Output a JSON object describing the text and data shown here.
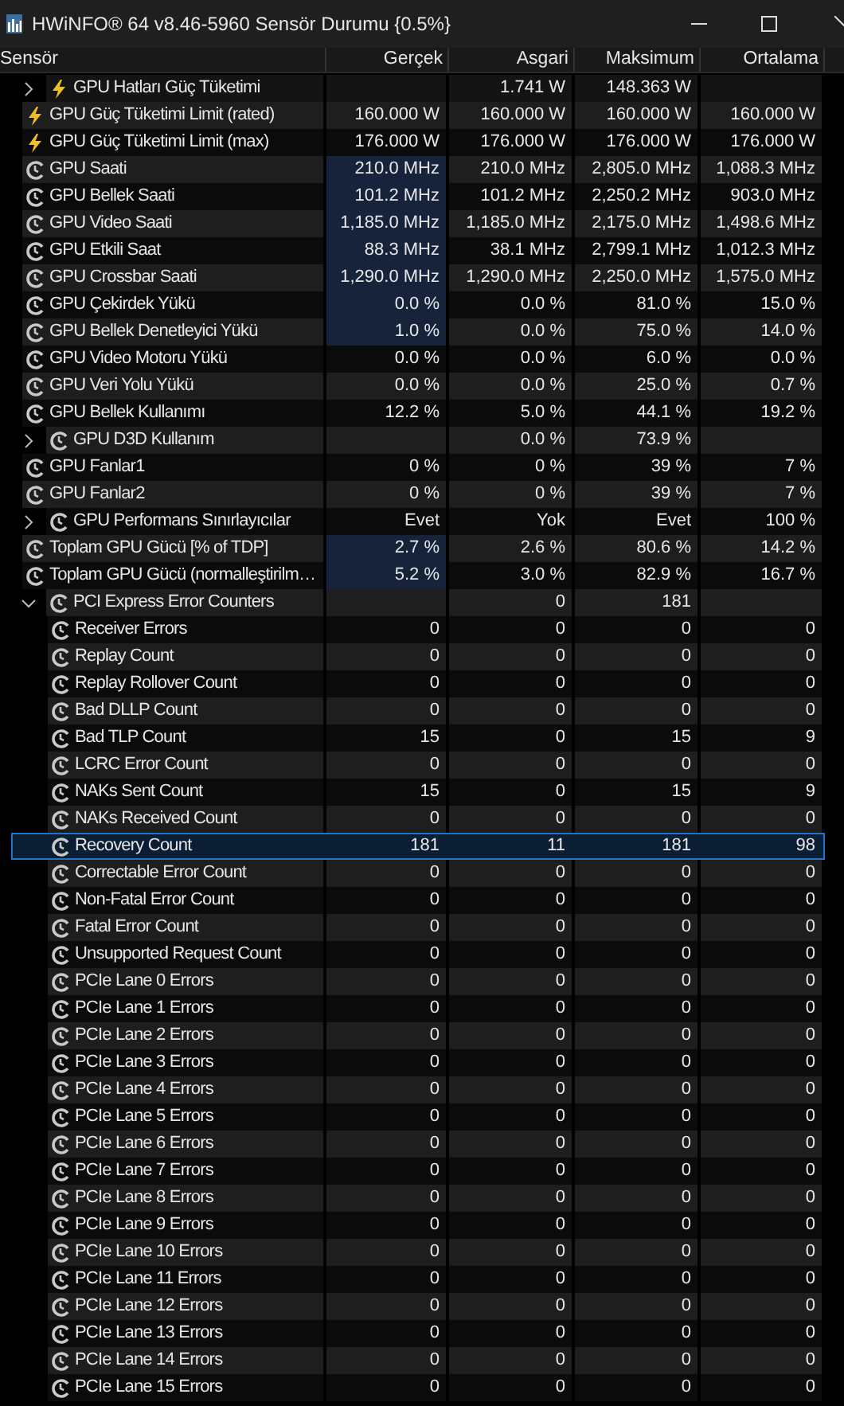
{
  "window": {
    "title": "HWiNFO® 64 v8.46-5960 Sensör Durumu {0.5%}"
  },
  "columns": [
    "Sensör",
    "Gerçek",
    "Asgari",
    "Maksimum",
    "Ortalama"
  ],
  "rows": [
    {
      "label": "GPU Hatları Güç Tüketimi",
      "kind": "power",
      "expanded": false,
      "min": "1.741 W",
      "max": "148.363 W",
      "highlight": false,
      "selected": false
    },
    {
      "label": "GPU Güç Tüketimi Limit (rated)",
      "kind": "power",
      "current": "160.000 W",
      "min": "160.000 W",
      "max": "160.000 W",
      "avg": "160.000 W",
      "highlight": false,
      "selected": false
    },
    {
      "label": "GPU Güç Tüketimi Limit (max)",
      "kind": "power",
      "current": "176.000 W",
      "min": "176.000 W",
      "max": "176.000 W",
      "avg": "176.000 W",
      "highlight": false,
      "selected": false
    },
    {
      "label": "GPU Saati",
      "kind": "clock",
      "current": "210.0 MHz",
      "min": "210.0 MHz",
      "max": "2,805.0 MHz",
      "avg": "1,088.3 MHz",
      "highlight": true,
      "selected": false
    },
    {
      "label": "GPU Bellek Saati",
      "kind": "clock",
      "current": "101.2 MHz",
      "min": "101.2 MHz",
      "max": "2,250.2 MHz",
      "avg": "903.0 MHz",
      "highlight": true,
      "selected": false
    },
    {
      "label": "GPU Video Saati",
      "kind": "clock",
      "current": "1,185.0 MHz",
      "min": "1,185.0 MHz",
      "max": "2,175.0 MHz",
      "avg": "1,498.6 MHz",
      "highlight": true,
      "selected": false
    },
    {
      "label": "GPU Etkili Saat",
      "kind": "clock",
      "current": "88.3 MHz",
      "min": "38.1 MHz",
      "max": "2,799.1 MHz",
      "avg": "1,012.3 MHz",
      "highlight": true,
      "selected": false
    },
    {
      "label": "GPU Crossbar Saati",
      "kind": "clock",
      "current": "1,290.0 MHz",
      "min": "1,290.0 MHz",
      "max": "2,250.0 MHz",
      "avg": "1,575.0 MHz",
      "highlight": true,
      "selected": false
    },
    {
      "label": "GPU Çekirdek Yükü",
      "kind": "clock",
      "current": "0.0 %",
      "min": "0.0 %",
      "max": "81.0 %",
      "avg": "15.0 %",
      "highlight": true,
      "selected": false
    },
    {
      "label": "GPU Bellek Denetleyici Yükü",
      "kind": "clock",
      "current": "1.0 %",
      "min": "0.0 %",
      "max": "75.0 %",
      "avg": "14.0 %",
      "highlight": true,
      "selected": false
    },
    {
      "label": "GPU Video Motoru Yükü",
      "kind": "clock",
      "current": "0.0 %",
      "min": "0.0 %",
      "max": "6.0 %",
      "avg": "0.0 %",
      "highlight": false,
      "selected": false
    },
    {
      "label": "GPU Veri Yolu Yükü",
      "kind": "clock",
      "current": "0.0 %",
      "min": "0.0 %",
      "max": "25.0 %",
      "avg": "0.7 %",
      "highlight": false,
      "selected": false
    },
    {
      "label": "GPU Bellek Kullanımı",
      "kind": "clock",
      "current": "12.2 %",
      "min": "5.0 %",
      "max": "44.1 %",
      "avg": "19.2 %",
      "highlight": false,
      "selected": false
    },
    {
      "label": "GPU D3D Kullanım",
      "kind": "clock",
      "expanded": false,
      "min": "0.0 %",
      "max": "73.9 %",
      "highlight": false,
      "selected": false
    },
    {
      "label": "GPU Fanlar1",
      "kind": "clock",
      "current": "0 %",
      "min": "0 %",
      "max": "39 %",
      "avg": "7 %",
      "highlight": false,
      "selected": false
    },
    {
      "label": "GPU Fanlar2",
      "kind": "clock",
      "current": "0 %",
      "min": "0 %",
      "max": "39 %",
      "avg": "7 %",
      "highlight": false,
      "selected": false
    },
    {
      "label": "GPU Performans Sınırlayıcılar",
      "kind": "clock",
      "expanded": false,
      "current": "Evet",
      "min": "Yok",
      "max": "Evet",
      "avg": "100 %",
      "highlight": false,
      "selected": false
    },
    {
      "label": "Toplam GPU Gücü [% of TDP]",
      "kind": "clock",
      "current": "2.7 %",
      "min": "2.6 %",
      "max": "80.6 %",
      "avg": "14.2 %",
      "highlight": true,
      "selected": false
    },
    {
      "label": "Toplam GPU Gücü (normalleştirilm…",
      "kind": "clock",
      "current": "5.2 %",
      "min": "3.0 %",
      "max": "82.9 %",
      "avg": "16.7 %",
      "highlight": true,
      "selected": false
    },
    {
      "label": "PCI Express Error Counters",
      "kind": "clock",
      "expanded": true,
      "min": "0",
      "max": "181",
      "highlight": false,
      "selected": false,
      "children": [
        {
          "label": "Receiver Errors",
          "kind": "clock",
          "current": "0",
          "min": "0",
          "max": "0",
          "avg": "0",
          "highlight": false,
          "selected": false
        },
        {
          "label": "Replay Count",
          "kind": "clock",
          "current": "0",
          "min": "0",
          "max": "0",
          "avg": "0",
          "highlight": false,
          "selected": false
        },
        {
          "label": "Replay Rollover Count",
          "kind": "clock",
          "current": "0",
          "min": "0",
          "max": "0",
          "avg": "0",
          "highlight": false,
          "selected": false
        },
        {
          "label": "Bad DLLP Count",
          "kind": "clock",
          "current": "0",
          "min": "0",
          "max": "0",
          "avg": "0",
          "highlight": false,
          "selected": false
        },
        {
          "label": "Bad TLP Count",
          "kind": "clock",
          "current": "15",
          "min": "0",
          "max": "15",
          "avg": "9",
          "highlight": false,
          "selected": false
        },
        {
          "label": "LCRC Error Count",
          "kind": "clock",
          "current": "0",
          "min": "0",
          "max": "0",
          "avg": "0",
          "highlight": false,
          "selected": false
        },
        {
          "label": "NAKs Sent Count",
          "kind": "clock",
          "current": "15",
          "min": "0",
          "max": "15",
          "avg": "9",
          "highlight": false,
          "selected": false
        },
        {
          "label": "NAKs Received Count",
          "kind": "clock",
          "current": "0",
          "min": "0",
          "max": "0",
          "avg": "0",
          "highlight": false,
          "selected": false
        },
        {
          "label": "Recovery Count",
          "kind": "clock",
          "current": "181",
          "min": "11",
          "max": "181",
          "avg": "98",
          "highlight": false,
          "selected": true
        },
        {
          "label": "Correctable Error Count",
          "kind": "clock",
          "current": "0",
          "min": "0",
          "max": "0",
          "avg": "0",
          "highlight": false,
          "selected": false
        },
        {
          "label": "Non-Fatal Error Count",
          "kind": "clock",
          "current": "0",
          "min": "0",
          "max": "0",
          "avg": "0",
          "highlight": false,
          "selected": false
        },
        {
          "label": "Fatal Error Count",
          "kind": "clock",
          "current": "0",
          "min": "0",
          "max": "0",
          "avg": "0",
          "highlight": false,
          "selected": false
        },
        {
          "label": "Unsupported Request Count",
          "kind": "clock",
          "current": "0",
          "min": "0",
          "max": "0",
          "avg": "0",
          "highlight": false,
          "selected": false
        },
        {
          "label": "PCIe Lane 0 Errors",
          "kind": "clock",
          "current": "0",
          "min": "0",
          "max": "0",
          "avg": "0",
          "highlight": false,
          "selected": false
        },
        {
          "label": "PCIe Lane 1 Errors",
          "kind": "clock",
          "current": "0",
          "min": "0",
          "max": "0",
          "avg": "0",
          "highlight": false,
          "selected": false
        },
        {
          "label": "PCIe Lane 2 Errors",
          "kind": "clock",
          "current": "0",
          "min": "0",
          "max": "0",
          "avg": "0",
          "highlight": false,
          "selected": false
        },
        {
          "label": "PCIe Lane 3 Errors",
          "kind": "clock",
          "current": "0",
          "min": "0",
          "max": "0",
          "avg": "0",
          "highlight": false,
          "selected": false
        },
        {
          "label": "PCIe Lane 4 Errors",
          "kind": "clock",
          "current": "0",
          "min": "0",
          "max": "0",
          "avg": "0",
          "highlight": false,
          "selected": false
        },
        {
          "label": "PCIe Lane 5 Errors",
          "kind": "clock",
          "current": "0",
          "min": "0",
          "max": "0",
          "avg": "0",
          "highlight": false,
          "selected": false
        },
        {
          "label": "PCIe Lane 6 Errors",
          "kind": "clock",
          "current": "0",
          "min": "0",
          "max": "0",
          "avg": "0",
          "highlight": false,
          "selected": false
        },
        {
          "label": "PCIe Lane 7 Errors",
          "kind": "clock",
          "current": "0",
          "min": "0",
          "max": "0",
          "avg": "0",
          "highlight": false,
          "selected": false
        },
        {
          "label": "PCIe Lane 8 Errors",
          "kind": "clock",
          "current": "0",
          "min": "0",
          "max": "0",
          "avg": "0",
          "highlight": false,
          "selected": false
        },
        {
          "label": "PCIe Lane 9 Errors",
          "kind": "clock",
          "current": "0",
          "min": "0",
          "max": "0",
          "avg": "0",
          "highlight": false,
          "selected": false
        },
        {
          "label": "PCIe Lane 10 Errors",
          "kind": "clock",
          "current": "0",
          "min": "0",
          "max": "0",
          "avg": "0",
          "highlight": false,
          "selected": false
        },
        {
          "label": "PCIe Lane 11 Errors",
          "kind": "clock",
          "current": "0",
          "min": "0",
          "max": "0",
          "avg": "0",
          "highlight": false,
          "selected": false
        },
        {
          "label": "PCIe Lane 12 Errors",
          "kind": "clock",
          "current": "0",
          "min": "0",
          "max": "0",
          "avg": "0",
          "highlight": false,
          "selected": false
        },
        {
          "label": "PCIe Lane 13 Errors",
          "kind": "clock",
          "current": "0",
          "min": "0",
          "max": "0",
          "avg": "0",
          "highlight": false,
          "selected": false
        },
        {
          "label": "PCIe Lane 14 Errors",
          "kind": "clock",
          "current": "0",
          "min": "0",
          "max": "0",
          "avg": "0",
          "highlight": false,
          "selected": false
        },
        {
          "label": "PCIe Lane 15 Errors",
          "kind": "clock",
          "current": "0",
          "min": "0",
          "max": "0",
          "avg": "0",
          "highlight": false,
          "selected": false
        }
      ]
    }
  ]
}
